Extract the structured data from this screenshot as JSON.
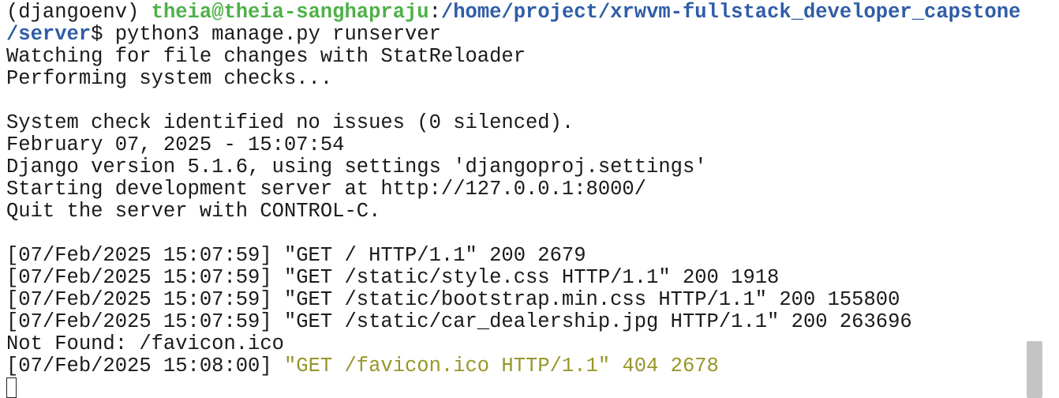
{
  "terminal": {
    "prompt": {
      "env": "(djangoenv) ",
      "user_host": "theia@theia-sanghapraju",
      "colon": ":",
      "path": "/home/project/xrwvm-fullstack_developer_capstone",
      "path_cont": "/server",
      "symbol": "$ ",
      "command": "python3 manage.py runserver"
    },
    "lines": {
      "l1": "Watching for file changes with StatReloader",
      "l2": "Performing system checks...",
      "l3": "",
      "l4": "System check identified no issues (0 silenced).",
      "l5": "February 07, 2025 - 15:07:54",
      "l6": "Django version 5.1.6, using settings 'djangoproj.settings'",
      "l7": "Starting development server at http://127.0.0.1:8000/",
      "l8": "Quit the server with CONTROL-C.",
      "l9": "",
      "l10": "[07/Feb/2025 15:07:59] \"GET / HTTP/1.1\" 200 2679",
      "l11": "[07/Feb/2025 15:07:59] \"GET /static/style.css HTTP/1.1\" 200 1918",
      "l12": "[07/Feb/2025 15:07:59] \"GET /static/bootstrap.min.css HTTP/1.1\" 200 155800",
      "l13": "[07/Feb/2025 15:07:59] \"GET /static/car_dealership.jpg HTTP/1.1\" 200 263696",
      "l14": "Not Found: /favicon.ico",
      "l15_prefix": "[07/Feb/2025 15:08:00] ",
      "l15_warn": "\"GET /favicon.ico HTTP/1.1\" 404 2678"
    },
    "colors": {
      "user_host": "#4fb04a",
      "path": "#2f5da8",
      "warning": "#97962a",
      "text": "#1a1a1a",
      "background": "#ffffff"
    }
  }
}
